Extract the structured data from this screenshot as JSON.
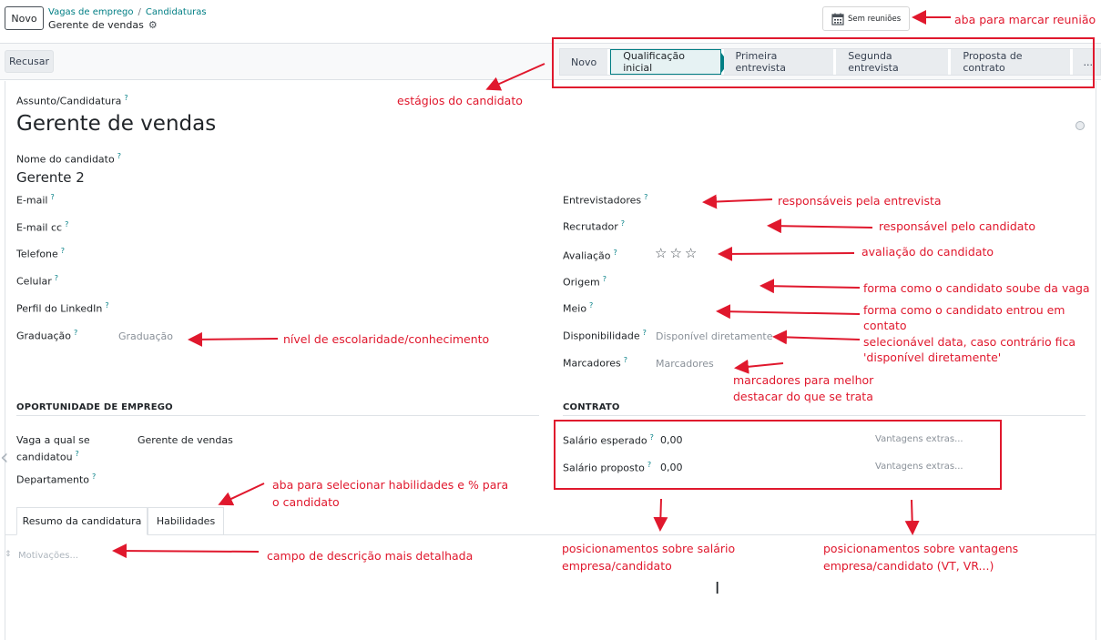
{
  "topbar": {
    "new_button": "Novo",
    "breadcrumb_jobs": "Vagas de emprego",
    "breadcrumb_sep": "/",
    "breadcrumb_applications": "Candidaturas",
    "current_record": "Gerente de vendas",
    "meetings_button": "Sem reuniões"
  },
  "actions": {
    "refuse_button": "Recusar"
  },
  "stages": [
    "Novo",
    "Qualificação inicial",
    "Primeira entrevista",
    "Segunda entrevista",
    "Proposta de contrato",
    "..."
  ],
  "active_stage_index": 1,
  "form": {
    "subject_label": "Assunto/Candidatura",
    "subject_value": "Gerente de vendas",
    "candidate_name_label": "Nome do candidato",
    "candidate_name_value": "Gerente 2",
    "email_label": "E-mail",
    "email_cc_label": "E-mail cc",
    "phone_label": "Telefone",
    "mobile_label": "Celular",
    "linkedin_label": "Perfil do LinkedIn",
    "degree_label": "Graduação",
    "degree_placeholder": "Graduação",
    "interviewers_label": "Entrevistadores",
    "recruiter_label": "Recrutador",
    "rating_label": "Avaliação",
    "rating_value": 0,
    "rating_max": 3,
    "source_label": "Origem",
    "medium_label": "Meio",
    "availability_label": "Disponibilidade",
    "availability_placeholder": "Disponível diretamente",
    "tags_label": "Marcadores",
    "tags_placeholder": "Marcadores",
    "help_mark": "?"
  },
  "job_section": {
    "title": "OPORTUNIDADE DE EMPREGO",
    "job_label_line1": "Vaga a qual se",
    "job_label_line2": "candidatou",
    "job_value": "Gerente de vendas",
    "department_label": "Departamento"
  },
  "contract_section": {
    "title": "CONTRATO",
    "expected_salary_label": "Salário esperado",
    "expected_salary_value": "0,00",
    "expected_extras_placeholder": "Vantagens extras...",
    "proposed_salary_label": "Salário proposto",
    "proposed_salary_value": "0,00",
    "proposed_extras_placeholder": "Vantagens extras..."
  },
  "tabs": [
    "Resumo da candidatura",
    "Habilidades"
  ],
  "summary_placeholder": "Motivações...",
  "annotations": {
    "meeting_tab": "aba para marcar reunião",
    "stages": "estágios do candidato",
    "interviewers": "responsáveis pela entrevista",
    "recruiter": "responsável pelo candidato",
    "rating": "avaliação do candidato",
    "source": "forma como o candidato soube da vaga",
    "medium_line1": "forma como o candidato entrou em",
    "medium_line2": "contato",
    "availability_line1": "selecionável data, caso contrário fica",
    "availability_line2": "'disponível diretamente'",
    "tags_line1": "marcadores para melhor",
    "tags_line2": "destacar do que se trata",
    "degree": "nível de escolaridade/conhecimento",
    "skills_line1": "aba para selecionar habilidades e % para",
    "skills_line2": "o candidato",
    "description": "campo de descrição mais detalhada",
    "salary_line1": "posicionamentos sobre salário",
    "salary_line2": "empresa/candidato",
    "benefits_line1": "posicionamentos sobre vantagens",
    "benefits_line2": "empresa/candidato (VT, VR...)"
  },
  "colors": {
    "annotation_red": "#e0182d",
    "brand_teal": "#017e84"
  }
}
